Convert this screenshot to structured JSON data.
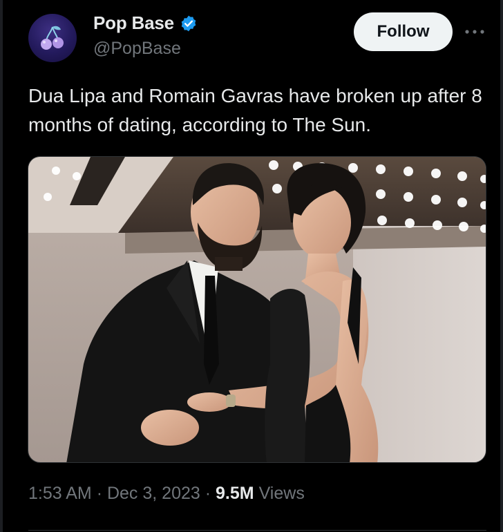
{
  "tweet": {
    "author": {
      "display_name": "Pop Base",
      "handle": "@PopBase",
      "verified": true,
      "avatar_icon": "cherry-icon"
    },
    "follow_label": "Follow",
    "more_icon": "more-horizontal-icon",
    "text": "Dua Lipa and Romain Gavras have broken up after 8 months of dating, according to The Sun.",
    "time": "1:53 AM",
    "date": "Dec 3, 2023",
    "separator": "·",
    "views_count": "9.5M",
    "views_label": "Views"
  },
  "colors": {
    "background": "#000000",
    "text_primary": "#e7e9ea",
    "text_secondary": "#71767b",
    "verified_badge": "#1d9bf0",
    "follow_bg": "#eff3f4",
    "avatar_bg": "#231a5c"
  }
}
